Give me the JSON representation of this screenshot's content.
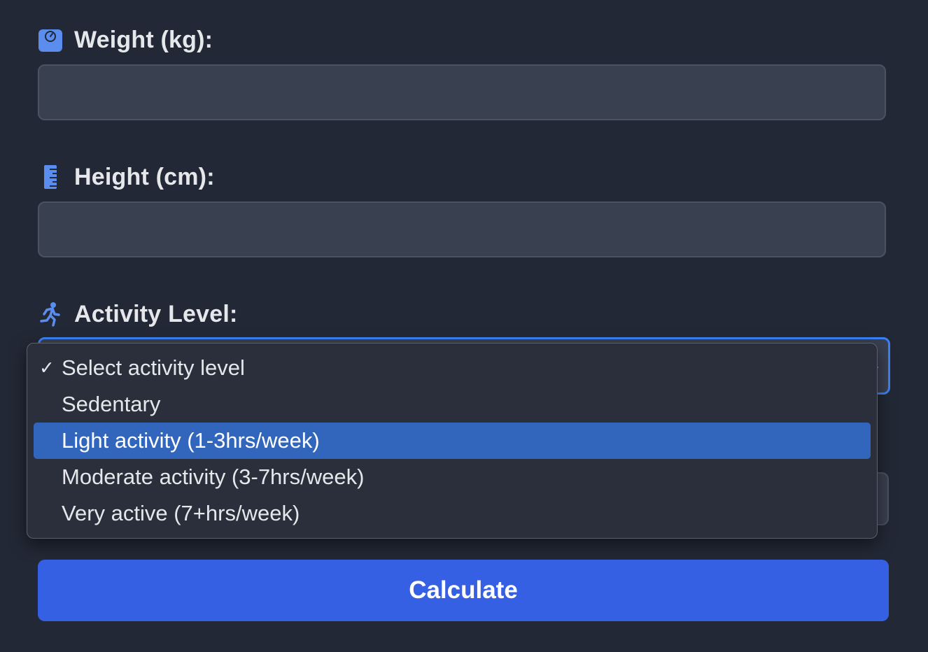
{
  "colors": {
    "background": "#222835",
    "input_bg": "#394050",
    "accent": "#3660e3",
    "focus_border": "#3b82f6",
    "highlight": "#3266bd",
    "icon": "#5b8def"
  },
  "weight": {
    "label": "Weight (kg):",
    "icon": "weight-scale-icon",
    "value": ""
  },
  "height": {
    "label": "Height (cm):",
    "icon": "ruler-icon",
    "value": ""
  },
  "activity": {
    "label": "Activity Level:",
    "icon": "running-person-icon",
    "selected": "Select activity level",
    "highlighted": "Light activity (1-3hrs/week)",
    "options": [
      "Select activity level",
      "Sedentary",
      "Light activity (1-3hrs/week)",
      "Moderate activity (3-7hrs/week)",
      "Very active (7+hrs/week)"
    ],
    "check_mark": "✓"
  },
  "calculate_button": {
    "label": "Calculate"
  }
}
